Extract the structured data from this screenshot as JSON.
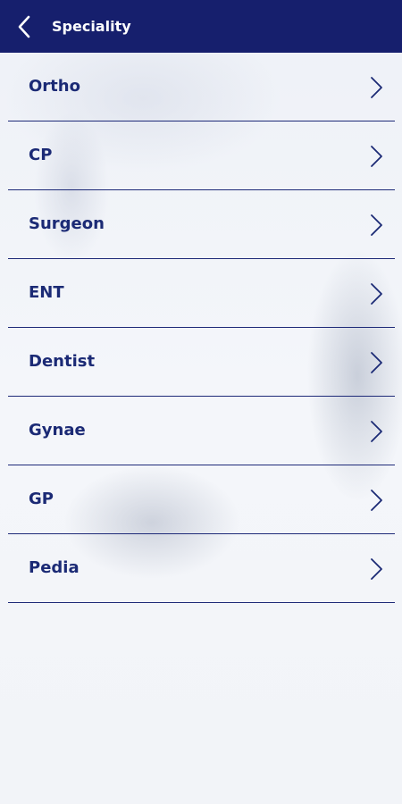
{
  "colors": {
    "header_bg": "#161f6d",
    "text": "#1b2a75",
    "divider": "#1e2a78"
  },
  "header": {
    "title": "Speciality",
    "back_icon": "chevron-left-icon"
  },
  "list": {
    "items": [
      {
        "label": "Ortho",
        "icon": "chevron-right-icon"
      },
      {
        "label": "CP",
        "icon": "chevron-right-icon"
      },
      {
        "label": "Surgeon",
        "icon": "chevron-right-icon"
      },
      {
        "label": "ENT",
        "icon": "chevron-right-icon"
      },
      {
        "label": "Dentist",
        "icon": "chevron-right-icon"
      },
      {
        "label": "Gynae",
        "icon": "chevron-right-icon"
      },
      {
        "label": "GP",
        "icon": "chevron-right-icon"
      },
      {
        "label": "Pedia",
        "icon": "chevron-right-icon"
      }
    ]
  }
}
